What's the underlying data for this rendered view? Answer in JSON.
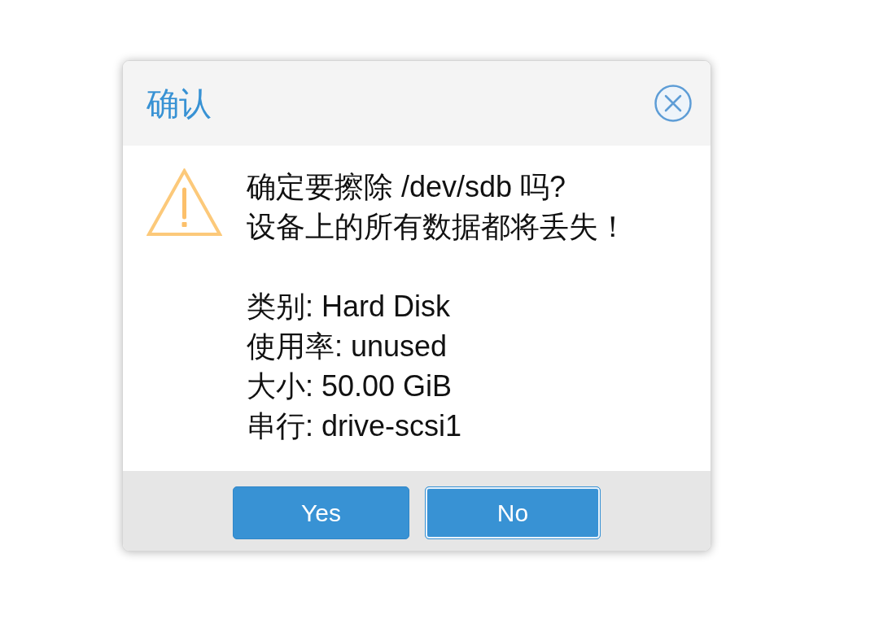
{
  "dialog": {
    "title": "确认",
    "message_lines": [
      "确定要擦除 /dev/sdb 吗?",
      "设备上的所有数据都将丢失！"
    ],
    "details": [
      "类别: Hard Disk",
      "使用率: unused",
      "大小: 50.00 GiB",
      "串行: drive-scsi1"
    ],
    "buttons": [
      {
        "label": "Yes",
        "focused": false
      },
      {
        "label": "No",
        "focused": true
      }
    ]
  }
}
